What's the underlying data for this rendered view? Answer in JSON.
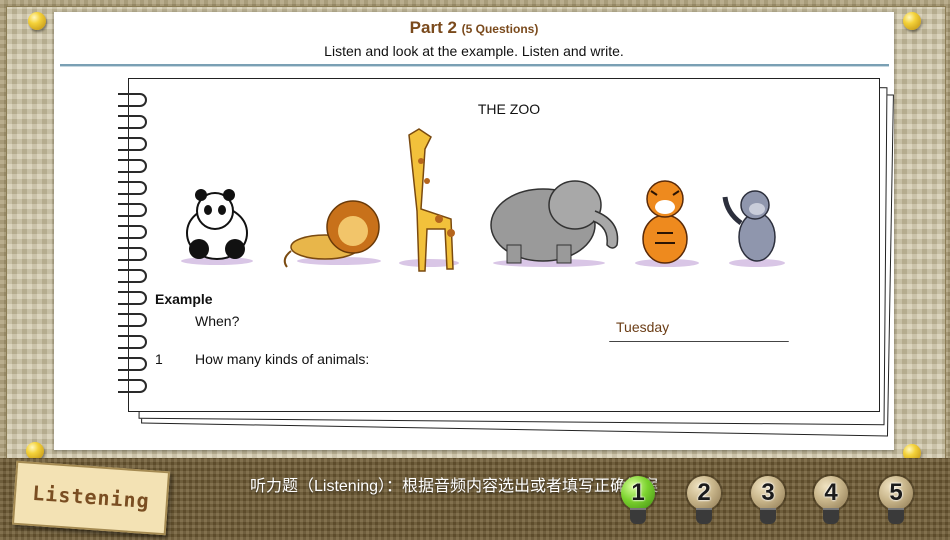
{
  "header": {
    "part_label": "Part 2",
    "question_count": "(5 Questions)",
    "instructions": "Listen and look at the example. Listen and write."
  },
  "notebook": {
    "title": "THE ZOO",
    "animals": [
      "panda-icon",
      "lion-icon",
      "giraffe-icon",
      "elephant-icon",
      "tiger-icon",
      "monkey-icon"
    ],
    "example_label": "Example",
    "example_question": "When?",
    "example_answer": "Tuesday",
    "q1_number": "1",
    "q1_text": "How many kinds of animals:"
  },
  "footer": {
    "badge_label": "Listening",
    "hint": "听力题（Listening）：根据音频内容选出或者填写正确答案",
    "questions": [
      {
        "label": "1",
        "active": true
      },
      {
        "label": "2",
        "active": false
      },
      {
        "label": "3",
        "active": false
      },
      {
        "label": "4",
        "active": false
      },
      {
        "label": "5",
        "active": false
      }
    ]
  },
  "colors": {
    "accent_title": "#7a4a1c",
    "active_bulb": "#7bd22e",
    "bar": "#6e5a33"
  }
}
